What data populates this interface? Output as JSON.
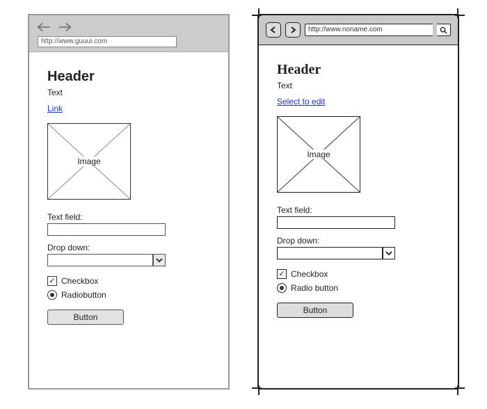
{
  "left": {
    "url": "http://www.guuui.com",
    "header": "Header",
    "text": "Text",
    "link": "Link",
    "image_label": "Image",
    "textfield_label": "Text field:",
    "dropdown_label": "Drop down:",
    "checkbox_label": "Checkbox",
    "radio_label": "Radiobutton",
    "button_label": "Button",
    "checkbox_checked": true,
    "radio_selected": true
  },
  "right": {
    "url": "http://www.noname.com",
    "header": "Header",
    "text": "Text",
    "link": "Select to edit",
    "image_label": "Image",
    "textfield_label": "Text field:",
    "dropdown_label": "Drop down:",
    "checkbox_label": "Checkbox",
    "radio_label": "Radio button",
    "button_label": "Button",
    "checkbox_checked": true,
    "radio_selected": true
  }
}
